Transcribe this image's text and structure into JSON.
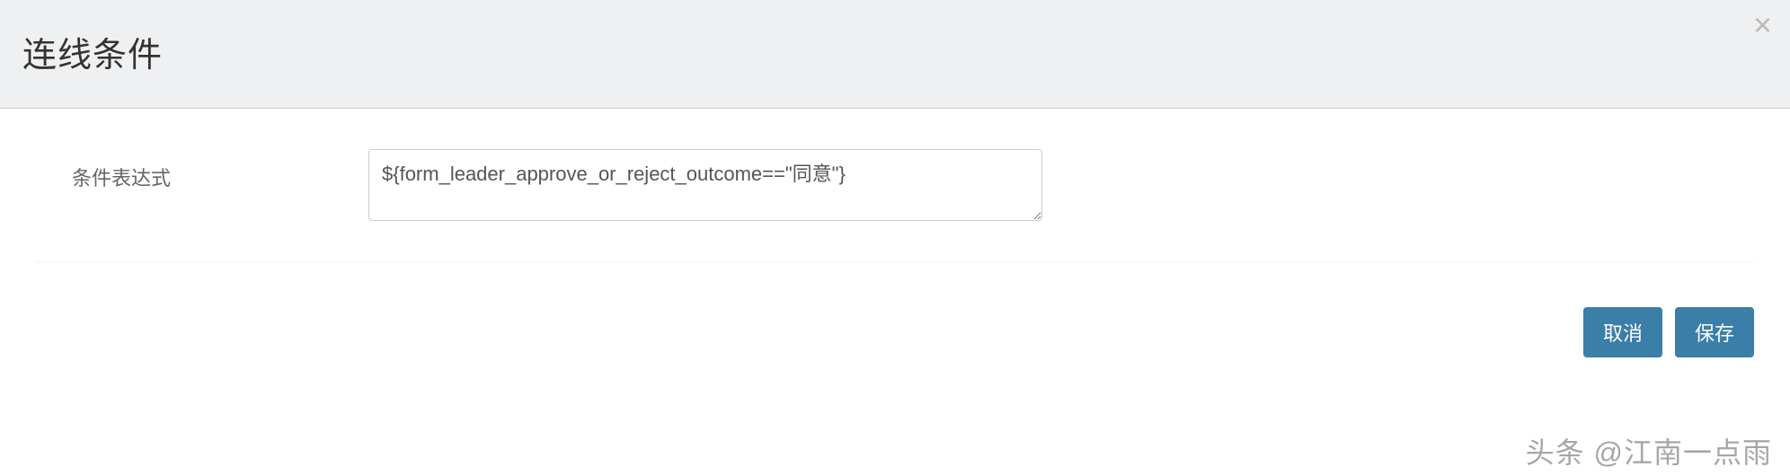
{
  "header": {
    "title": "连线条件",
    "close_label": "×"
  },
  "form": {
    "expression_label": "条件表达式",
    "expression_value": "${form_leader_approve_or_reject_outcome==\"同意\"}"
  },
  "footer": {
    "cancel_label": "取消",
    "save_label": "保存"
  },
  "watermark": "头条 @江南一点雨"
}
